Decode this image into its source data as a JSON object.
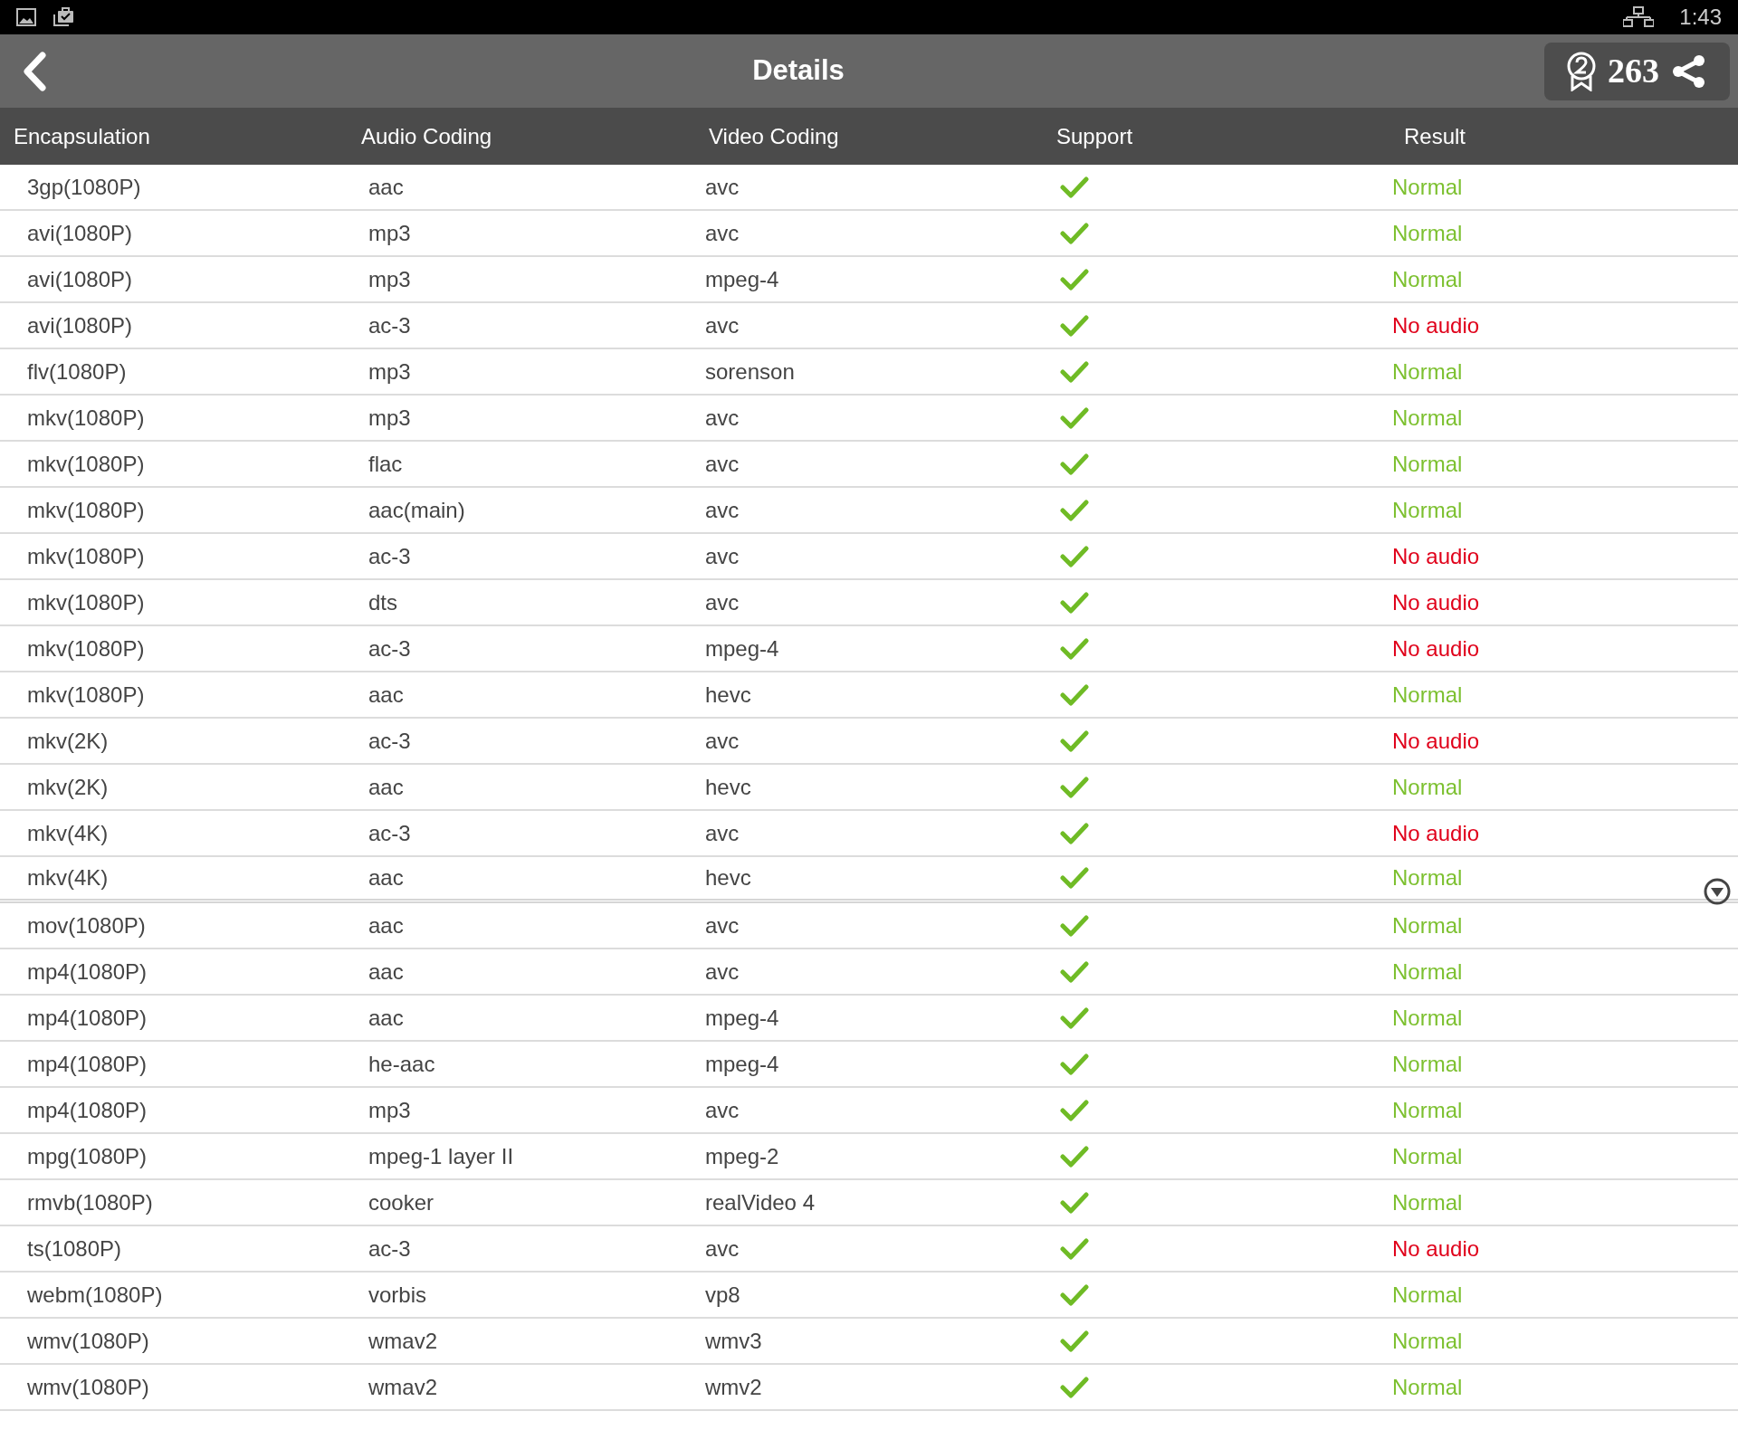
{
  "status_bar": {
    "time": "1:43"
  },
  "header": {
    "title": "Details",
    "score": "263"
  },
  "table": {
    "columns": [
      "Encapsulation",
      "Audio Coding",
      "Video Coding",
      "Support",
      "Result"
    ],
    "rows": [
      {
        "encapsulation": "3gp(1080P)",
        "audio": "aac",
        "video": "avc",
        "supported": true,
        "result": "Normal",
        "kind": "normal"
      },
      {
        "encapsulation": "avi(1080P)",
        "audio": "mp3",
        "video": "avc",
        "supported": true,
        "result": "Normal",
        "kind": "normal"
      },
      {
        "encapsulation": "avi(1080P)",
        "audio": "mp3",
        "video": "mpeg-4",
        "supported": true,
        "result": "Normal",
        "kind": "normal"
      },
      {
        "encapsulation": "avi(1080P)",
        "audio": "ac-3",
        "video": "avc",
        "supported": true,
        "result": "No audio",
        "kind": "problem"
      },
      {
        "encapsulation": "flv(1080P)",
        "audio": "mp3",
        "video": "sorenson",
        "supported": true,
        "result": "Normal",
        "kind": "normal"
      },
      {
        "encapsulation": "mkv(1080P)",
        "audio": "mp3",
        "video": "avc",
        "supported": true,
        "result": "Normal",
        "kind": "normal"
      },
      {
        "encapsulation": "mkv(1080P)",
        "audio": "flac",
        "video": "avc",
        "supported": true,
        "result": "Normal",
        "kind": "normal"
      },
      {
        "encapsulation": "mkv(1080P)",
        "audio": "aac(main)",
        "video": "avc",
        "supported": true,
        "result": "Normal",
        "kind": "normal"
      },
      {
        "encapsulation": "mkv(1080P)",
        "audio": "ac-3",
        "video": "avc",
        "supported": true,
        "result": "No audio",
        "kind": "problem"
      },
      {
        "encapsulation": "mkv(1080P)",
        "audio": "dts",
        "video": "avc",
        "supported": true,
        "result": "No audio",
        "kind": "problem"
      },
      {
        "encapsulation": "mkv(1080P)",
        "audio": "ac-3",
        "video": "mpeg-4",
        "supported": true,
        "result": "No audio",
        "kind": "problem"
      },
      {
        "encapsulation": "mkv(1080P)",
        "audio": "aac",
        "video": "hevc",
        "supported": true,
        "result": "Normal",
        "kind": "normal"
      },
      {
        "encapsulation": "mkv(2K)",
        "audio": "ac-3",
        "video": "avc",
        "supported": true,
        "result": "No audio",
        "kind": "problem"
      },
      {
        "encapsulation": "mkv(2K)",
        "audio": "aac",
        "video": "hevc",
        "supported": true,
        "result": "Normal",
        "kind": "normal"
      },
      {
        "encapsulation": "mkv(4K)",
        "audio": "ac-3",
        "video": "avc",
        "supported": true,
        "result": "No audio",
        "kind": "problem"
      },
      {
        "encapsulation": "mkv(4K)",
        "audio": "aac",
        "video": "hevc",
        "supported": true,
        "result": "Normal",
        "kind": "normal"
      },
      {
        "encapsulation": "mov(1080P)",
        "audio": "aac",
        "video": "avc",
        "supported": true,
        "result": "Normal",
        "kind": "normal"
      },
      {
        "encapsulation": "mp4(1080P)",
        "audio": "aac",
        "video": "avc",
        "supported": true,
        "result": "Normal",
        "kind": "normal"
      },
      {
        "encapsulation": "mp4(1080P)",
        "audio": "aac",
        "video": "mpeg-4",
        "supported": true,
        "result": "Normal",
        "kind": "normal"
      },
      {
        "encapsulation": "mp4(1080P)",
        "audio": "he-aac",
        "video": "mpeg-4",
        "supported": true,
        "result": "Normal",
        "kind": "normal"
      },
      {
        "encapsulation": "mp4(1080P)",
        "audio": "mp3",
        "video": "avc",
        "supported": true,
        "result": "Normal",
        "kind": "normal"
      },
      {
        "encapsulation": "mpg(1080P)",
        "audio": "mpeg-1 layer II",
        "video": "mpeg-2",
        "supported": true,
        "result": "Normal",
        "kind": "normal"
      },
      {
        "encapsulation": "rmvb(1080P)",
        "audio": "cooker",
        "video": "realVideo 4",
        "supported": true,
        "result": "Normal",
        "kind": "normal"
      },
      {
        "encapsulation": "ts(1080P)",
        "audio": "ac-3",
        "video": "avc",
        "supported": true,
        "result": "No audio",
        "kind": "problem"
      },
      {
        "encapsulation": "webm(1080P)",
        "audio": "vorbis",
        "video": "vp8",
        "supported": true,
        "result": "Normal",
        "kind": "normal"
      },
      {
        "encapsulation": "wmv(1080P)",
        "audio": "wmav2",
        "video": "wmv3",
        "supported": true,
        "result": "Normal",
        "kind": "normal"
      },
      {
        "encapsulation": "wmv(1080P)",
        "audio": "wmav2",
        "video": "wmv2",
        "supported": true,
        "result": "Normal",
        "kind": "normal"
      }
    ]
  }
}
